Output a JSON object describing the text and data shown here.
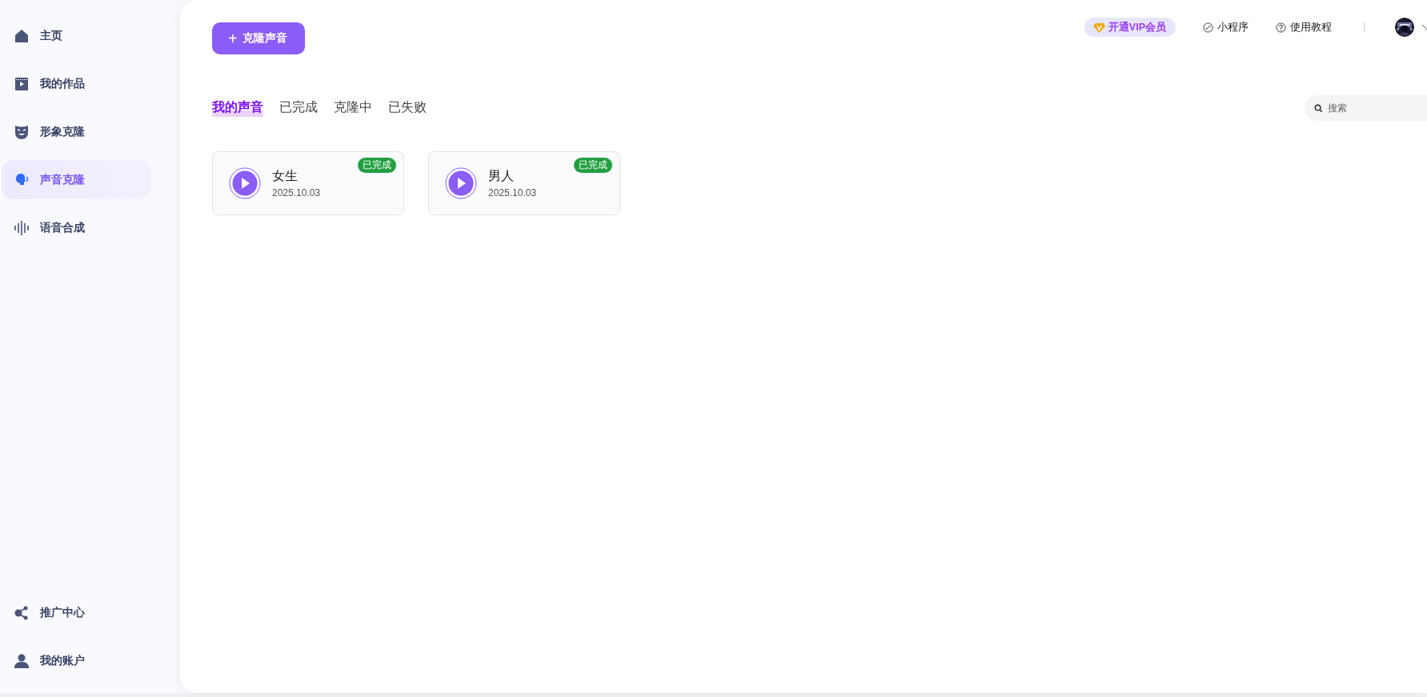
{
  "sidebar": {
    "items": [
      {
        "label": "主页",
        "selected": false
      },
      {
        "label": "我的作品",
        "selected": false
      },
      {
        "label": "形象克隆",
        "selected": false
      },
      {
        "label": "声音克隆",
        "selected": true
      },
      {
        "label": "语音合成",
        "selected": false
      }
    ],
    "bottom_items": [
      {
        "label": "推广中心",
        "selected": false
      },
      {
        "label": "我的账户",
        "selected": false
      }
    ]
  },
  "top_bar": {
    "vip": "开通VIP会员",
    "links": [
      "小程序",
      "使用教程"
    ]
  },
  "clone_button": {
    "icon": "+",
    "label": "克隆声音"
  },
  "tabs": [
    {
      "label": "我的声音",
      "selected": true
    },
    {
      "label": "已完成",
      "selected": false
    },
    {
      "label": "克隆中",
      "selected": false
    },
    {
      "label": "已失败",
      "selected": false
    }
  ],
  "search": {
    "placeholder": "搜索"
  },
  "voices": [
    {
      "name": "女生",
      "date": "2025.10.03",
      "status": "已完成"
    },
    {
      "name": "男人",
      "date": "2025.10.03",
      "status": "已完成"
    }
  ]
}
